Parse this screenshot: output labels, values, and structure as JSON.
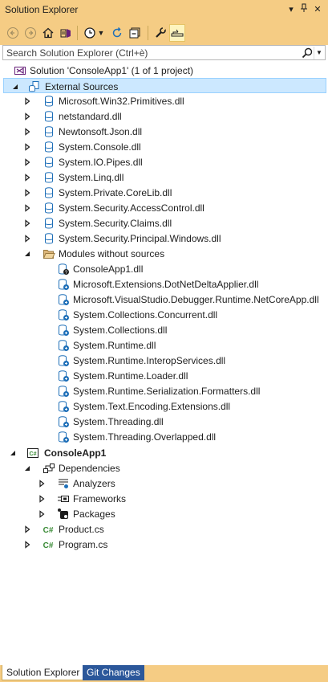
{
  "window": {
    "title": "Solution Explorer"
  },
  "search": {
    "placeholder": "Search Solution Explorer (Ctrl+è)"
  },
  "tree": {
    "solution": "Solution 'ConsoleApp1' (1 of 1 project)",
    "external_sources": "External Sources",
    "external_dlls": [
      "Microsoft.Win32.Primitives.dll",
      "netstandard.dll",
      "Newtonsoft.Json.dll",
      "System.Console.dll",
      "System.IO.Pipes.dll",
      "System.Linq.dll",
      "System.Private.CoreLib.dll",
      "System.Security.AccessControl.dll",
      "System.Security.Claims.dll",
      "System.Security.Principal.Windows.dll"
    ],
    "modules_folder": "Modules without sources",
    "modules": [
      "ConsoleApp1.dll",
      "Microsoft.Extensions.DotNetDeltaApplier.dll",
      "Microsoft.VisualStudio.Debugger.Runtime.NetCoreApp.dll",
      "System.Collections.Concurrent.dll",
      "System.Collections.dll",
      "System.Runtime.dll",
      "System.Runtime.InteropServices.dll",
      "System.Runtime.Loader.dll",
      "System.Runtime.Serialization.Formatters.dll",
      "System.Text.Encoding.Extensions.dll",
      "System.Threading.dll",
      "System.Threading.Overlapped.dll"
    ],
    "project": "ConsoleApp1",
    "dependencies": "Dependencies",
    "analyzers": "Analyzers",
    "frameworks": "Frameworks",
    "packages": "Packages",
    "files": [
      "Product.cs",
      "Program.cs"
    ]
  },
  "bottom_tabs": [
    "Solution Explorer",
    "Git Changes"
  ],
  "colors": {
    "accent": "#f5cc84",
    "selection": "#cce8ff",
    "tab_inactive": "#2b579a",
    "cs_green": "#388a34",
    "ref_blue": "#1e6fb8"
  }
}
